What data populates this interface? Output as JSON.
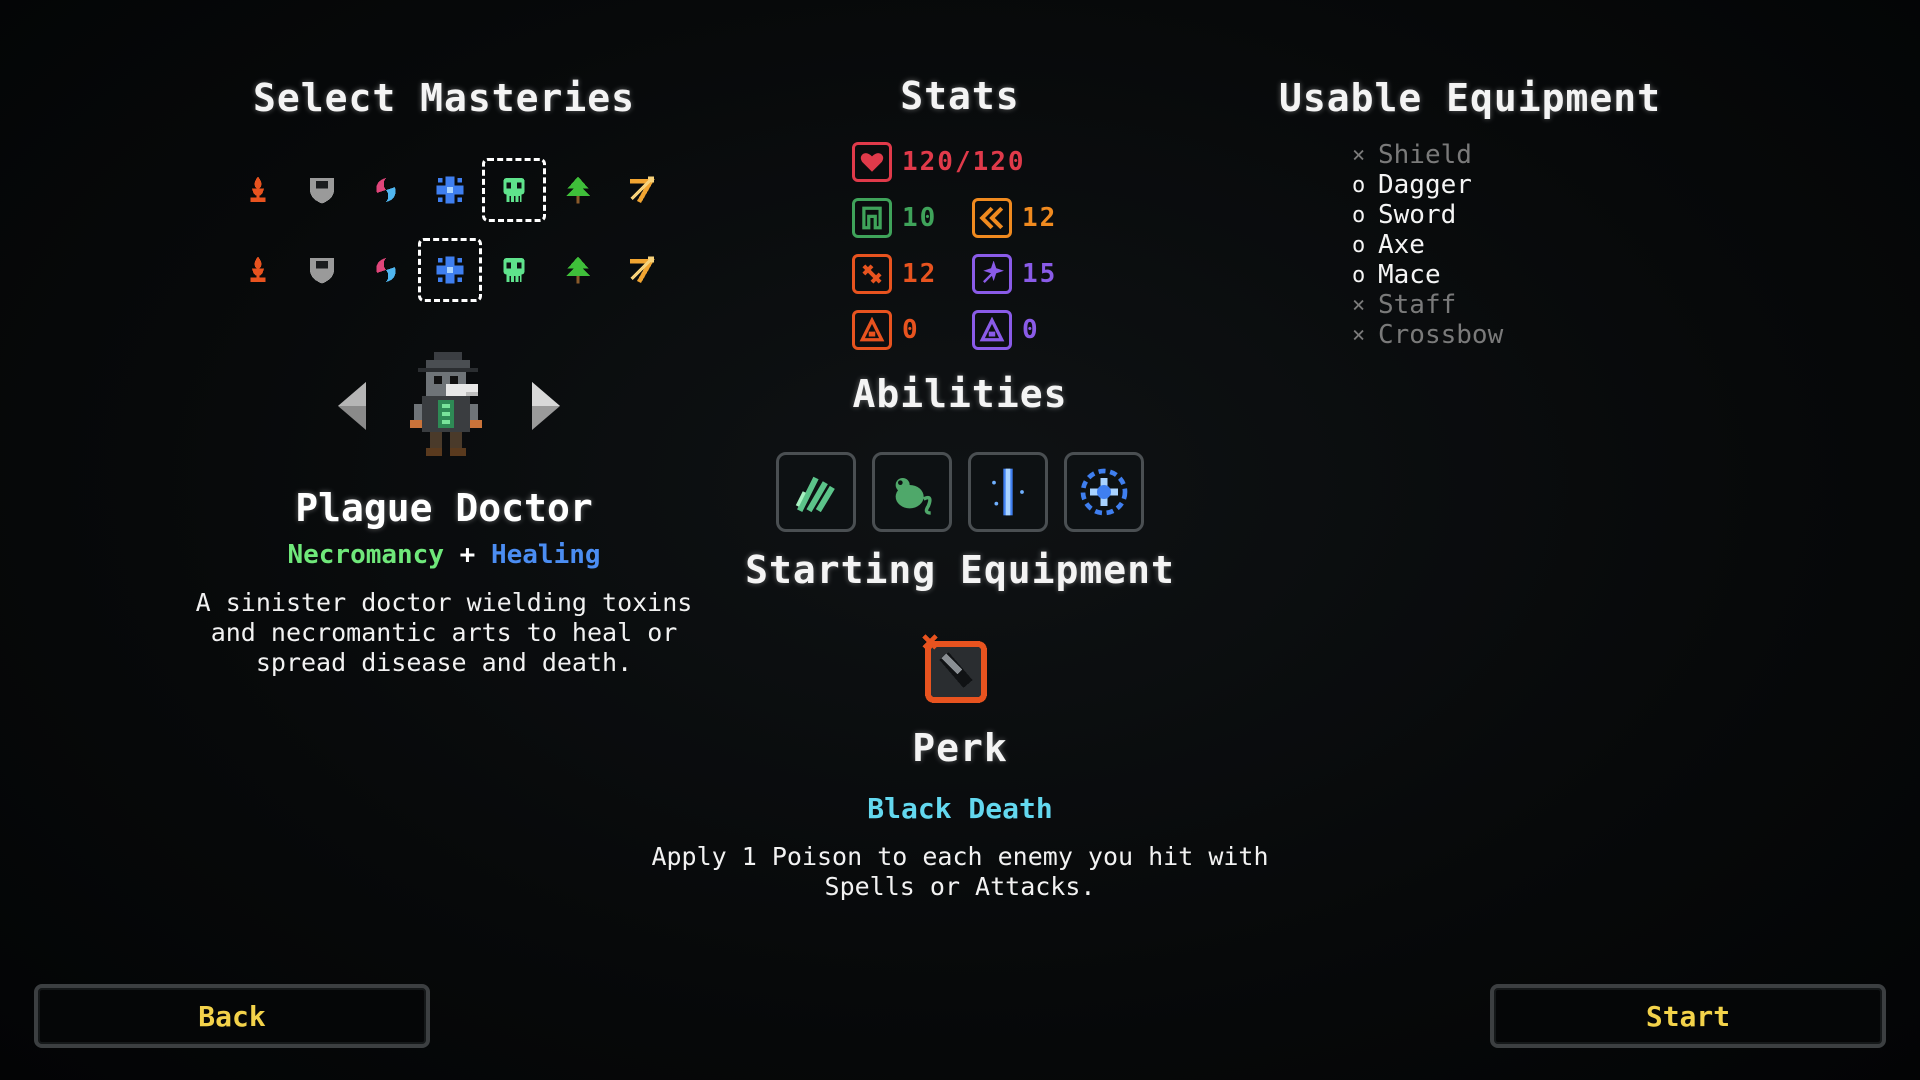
{
  "masteries": {
    "title": "Select Masteries",
    "icons": [
      {
        "name": "fire-mastery-icon",
        "color": "#e8531f"
      },
      {
        "name": "shield-mastery-icon",
        "color": "#9a9a9a"
      },
      {
        "name": "elemental-mastery-icon",
        "color": "#e0457a"
      },
      {
        "name": "healing-mastery-icon",
        "color": "#3f7ff0"
      },
      {
        "name": "necromancy-mastery-icon",
        "color": "#5fe38c"
      },
      {
        "name": "nature-mastery-icon",
        "color": "#3fbf3a"
      },
      {
        "name": "ranged-mastery-icon",
        "color": "#f2a531"
      }
    ],
    "row1_selected": 4,
    "row2_selected": 3
  },
  "character": {
    "name": "Plague Doctor",
    "mastery1": "Necromancy",
    "plus": "+",
    "mastery2": "Healing",
    "description": "A sinister doctor wielding toxins and necromantic arts to heal or spread disease and death.",
    "prev_icon": "left-arrow-icon",
    "next_icon": "right-arrow-icon"
  },
  "stats": {
    "title": "Stats",
    "health": "120/120",
    "armor": "10",
    "speed": "12",
    "attack": "12",
    "spell": "15",
    "fire_resist": "0",
    "magic_resist": "0",
    "colors": {
      "health": "#e03a4a",
      "armor": "#3fa35a",
      "speed": "#f08a1f",
      "attack": "#e8531f",
      "spell": "#8a5be8",
      "fire_resist": "#e8531f",
      "magic_resist": "#8a5be8"
    }
  },
  "abilities": {
    "title": "Abilities",
    "items": [
      "claw-ability-icon",
      "rat-ability-icon",
      "beam-ability-icon",
      "aura-ability-icon"
    ]
  },
  "starting_equipment": {
    "title": "Starting Equipment",
    "item_icon": "dagger-item-icon"
  },
  "perk": {
    "title": "Perk",
    "name": "Black Death",
    "description": "Apply 1 Poison to each enemy you hit with Spells or Attacks."
  },
  "usable_equipment": {
    "title": "Usable Equipment",
    "items": [
      {
        "mark": "×",
        "label": "Shield",
        "usable": false
      },
      {
        "mark": "o",
        "label": "Dagger",
        "usable": true
      },
      {
        "mark": "o",
        "label": "Sword",
        "usable": true
      },
      {
        "mark": "o",
        "label": "Axe",
        "usable": true
      },
      {
        "mark": "o",
        "label": "Mace",
        "usable": true
      },
      {
        "mark": "×",
        "label": "Staff",
        "usable": false
      },
      {
        "mark": "×",
        "label": "Crossbow",
        "usable": false
      }
    ]
  },
  "buttons": {
    "back": "Back",
    "start": "Start"
  }
}
